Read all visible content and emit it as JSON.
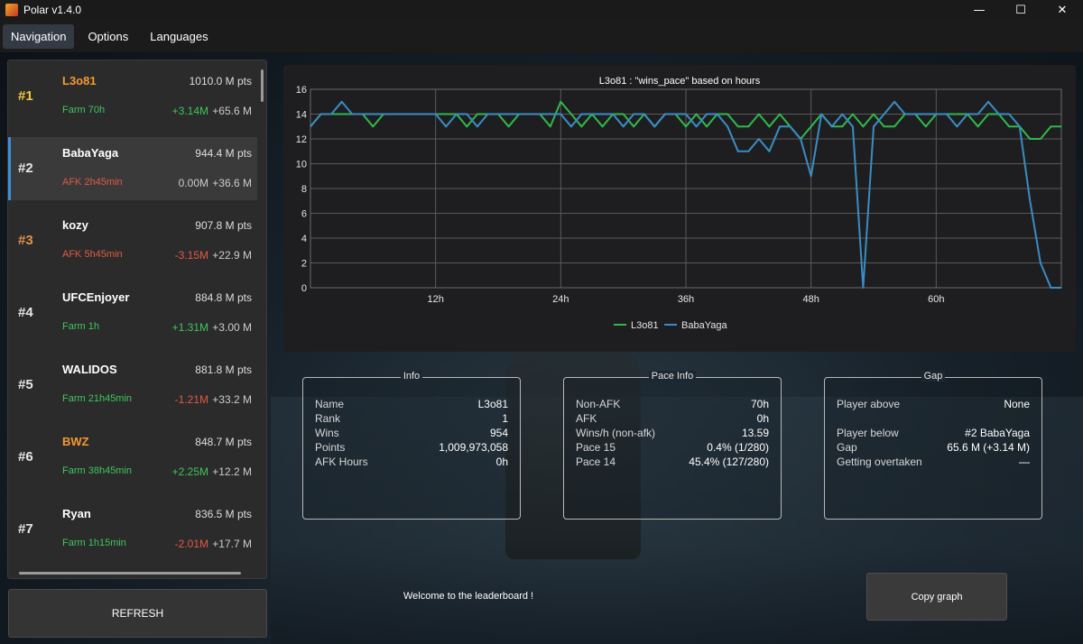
{
  "window": {
    "title": "Polar v1.4.0",
    "controls": {
      "minimize": "—",
      "maximize": "☐",
      "close": "✕"
    }
  },
  "menu": [
    "Navigation",
    "Options",
    "Languages"
  ],
  "players": [
    {
      "rank": "#1",
      "name": "L3o81",
      "points": "1010.0 M pts",
      "status": "Farm 70h",
      "delta": "+3.14M",
      "gap": "+65.6 M",
      "rank_style": "gold",
      "name_style": "orange",
      "status_style": "green",
      "delta_style": "green"
    },
    {
      "rank": "#2",
      "name": "BabaYaga",
      "points": "944.4 M pts",
      "status": "AFK 2h45min",
      "delta": "0.00M",
      "gap": "+36.6 M",
      "rank_style": "",
      "name_style": "",
      "status_style": "red",
      "delta_style": "grey"
    },
    {
      "rank": "#3",
      "name": "kozy",
      "points": "907.8 M pts",
      "status": "AFK 5h45min",
      "delta": "-3.15M",
      "gap": "+22.9 M",
      "rank_style": "bronze",
      "name_style": "",
      "status_style": "red",
      "delta_style": "red"
    },
    {
      "rank": "#4",
      "name": "UFCEnjoyer",
      "points": "884.8 M pts",
      "status": "Farm 1h",
      "delta": "+1.31M",
      "gap": "+3.00 M",
      "rank_style": "",
      "name_style": "",
      "status_style": "green",
      "delta_style": "green"
    },
    {
      "rank": "#5",
      "name": "WALIDOS",
      "points": "881.8 M pts",
      "status": "Farm 21h45min",
      "delta": "-1.21M",
      "gap": "+33.2 M",
      "rank_style": "",
      "name_style": "",
      "status_style": "green",
      "delta_style": "red"
    },
    {
      "rank": "#6",
      "name": "BWZ",
      "points": "848.7 M pts",
      "status": "Farm 38h45min",
      "delta": "+2.25M",
      "gap": "+12.2 M",
      "rank_style": "",
      "name_style": "orange",
      "status_style": "green",
      "delta_style": "green"
    },
    {
      "rank": "#7",
      "name": "Ryan",
      "points": "836.5 M pts",
      "status": "Farm 1h15min",
      "delta": "-2.01M",
      "gap": "+17.7 M",
      "rank_style": "",
      "name_style": "",
      "status_style": "green",
      "delta_style": "red"
    }
  ],
  "buttons": {
    "refresh": "REFRESH",
    "copy_graph": "Copy graph"
  },
  "welcome": "Welcome to the leaderboard !",
  "info": {
    "title": "Info",
    "rows": [
      {
        "k": "Name",
        "v": "L3o81"
      },
      {
        "k": "Rank",
        "v": "1"
      },
      {
        "k": "Wins",
        "v": "954"
      },
      {
        "k": "Points",
        "v": "1,009,973,058"
      },
      {
        "k": "AFK Hours",
        "v": "0h"
      }
    ]
  },
  "pace_info": {
    "title": "Pace Info",
    "rows": [
      {
        "k": "Non-AFK",
        "v": "70h"
      },
      {
        "k": "AFK",
        "v": "0h"
      },
      {
        "k": "Wins/h (non-afk)",
        "v": "13.59"
      },
      {
        "k": "Pace 15",
        "v": "0.4% (1/280)"
      },
      {
        "k": "Pace 14",
        "v": "45.4% (127/280)"
      }
    ]
  },
  "gap": {
    "title": "Gap",
    "rows": [
      {
        "k": "Player above",
        "v": "None"
      },
      {
        "k": "Player below",
        "v": "#2 BabaYaga"
      },
      {
        "k": "Gap",
        "v": "65.6 M (+3.14 M)"
      },
      {
        "k": "Getting overtaken",
        "v": "—"
      }
    ]
  },
  "colors": {
    "accent": "#3d8fd6",
    "series_l3o81": "#2fb84a",
    "series_babayaga": "#3a8cc4",
    "positive": "#3fc55e",
    "negative": "#e05a45"
  },
  "chart_data": {
    "type": "line",
    "title": "L3o81 : \"wins_pace\" based on hours",
    "xlabel": "",
    "ylabel": "",
    "xlim": [
      0,
      72
    ],
    "ylim": [
      0,
      16
    ],
    "x_ticks": [
      "12h",
      "24h",
      "36h",
      "48h",
      "60h"
    ],
    "x_tick_values": [
      12,
      24,
      36,
      48,
      60
    ],
    "y_ticks": [
      0,
      2,
      4,
      6,
      8,
      10,
      12,
      14,
      16
    ],
    "grid": true,
    "legend": "bottom-center",
    "x": [
      0,
      1,
      2,
      3,
      4,
      5,
      6,
      7,
      8,
      9,
      10,
      11,
      12,
      13,
      14,
      15,
      16,
      17,
      18,
      19,
      20,
      21,
      22,
      23,
      24,
      25,
      26,
      27,
      28,
      29,
      30,
      31,
      32,
      33,
      34,
      35,
      36,
      37,
      38,
      39,
      40,
      41,
      42,
      43,
      44,
      45,
      46,
      47,
      48,
      49,
      50,
      51,
      52,
      53,
      54,
      55,
      56,
      57,
      58,
      59,
      60,
      61,
      62,
      63,
      64,
      65,
      66,
      67,
      68,
      69,
      70,
      71,
      72
    ],
    "series": [
      {
        "name": "L3o81",
        "values": [
          13,
          14,
          14,
          14,
          14,
          14,
          13,
          14,
          14,
          14,
          14,
          14,
          14,
          14,
          14,
          13,
          14,
          14,
          14,
          13,
          14,
          14,
          14,
          13,
          15,
          14,
          13,
          14,
          13,
          14,
          14,
          13,
          14,
          13,
          14,
          14,
          13,
          14,
          13,
          14,
          14,
          13,
          13,
          14,
          13,
          14,
          13,
          12,
          13,
          14,
          13,
          13,
          14,
          13,
          14,
          13,
          13,
          14,
          14,
          13,
          14,
          14,
          14,
          14,
          13,
          14,
          14,
          13,
          13,
          12,
          12,
          13,
          13
        ]
      },
      {
        "name": "BabaYaga",
        "values": [
          13,
          14,
          14,
          15,
          14,
          14,
          14,
          14,
          14,
          14,
          14,
          14,
          14,
          13,
          14,
          14,
          13,
          14,
          14,
          14,
          14,
          14,
          14,
          14,
          14,
          13,
          14,
          14,
          14,
          14,
          13,
          14,
          14,
          13,
          14,
          14,
          14,
          13,
          14,
          14,
          13,
          11,
          11,
          12,
          11,
          13,
          13,
          12,
          9,
          14,
          13,
          14,
          13,
          0,
          13,
          14,
          15,
          14,
          14,
          14,
          14,
          14,
          13,
          14,
          14,
          15,
          14,
          14,
          13,
          7,
          2,
          0,
          0
        ]
      }
    ]
  }
}
